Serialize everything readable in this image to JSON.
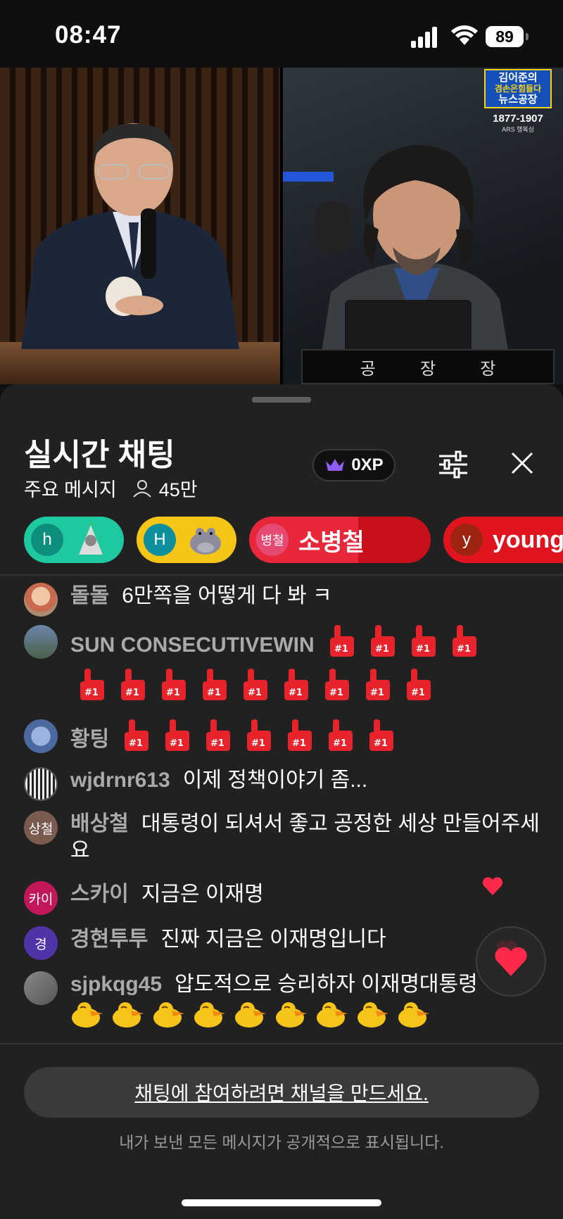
{
  "status_bar": {
    "time": "08:47",
    "battery": "89"
  },
  "video": {
    "nameplate": [
      "공",
      "장",
      "장"
    ],
    "logo": {
      "line1": "김어준의",
      "line2": "겸손은힘들다",
      "line3": "뉴스공장",
      "phone": "1877-1907",
      "ars": "ARS 행복심"
    }
  },
  "chat": {
    "title": "실시간 채팅",
    "mode_label": "주요 메시지",
    "viewer_count": "45만",
    "xp": "0XP"
  },
  "pinned": [
    {
      "initial": "h",
      "name": "",
      "color": "#1ec9a0"
    },
    {
      "initial": "H",
      "name": "",
      "color": "#f5c518"
    },
    {
      "initial": "병철",
      "name": "소병철",
      "color": "#e0141e"
    },
    {
      "initial": "y",
      "name": "young",
      "color": "#e0141e"
    }
  ],
  "messages": [
    {
      "author": "돌돌",
      "text": "6만쪽을 어떻게 다 봐 ㅋ",
      "avatar": ""
    },
    {
      "author": "SUN CONSECUTIVEWIN",
      "text": "",
      "avatar": ""
    },
    {
      "author": "황팅",
      "text": "",
      "avatar": ""
    },
    {
      "author": "wjdrnr613",
      "text": "이제 정책이야기 좀...",
      "avatar": ""
    },
    {
      "author": "배상철",
      "text": "대통령이 되셔서 좋고 공정한 세상 만들어주세요",
      "avatar": "상철"
    },
    {
      "author": "스카이",
      "text": "지금은 이재명",
      "avatar": "카이"
    },
    {
      "author": "경현투투",
      "text": "진짜 지금은 이재명입니다",
      "avatar": "경"
    },
    {
      "author": "sjpkqg45",
      "text": "압도적으로 승리하자 이재명대통령",
      "avatar": ""
    }
  ],
  "footer": {
    "join_text": "채팅에 참여하려면 채널을 만드세요.",
    "notice": "내가 보낸 모든 메시지가 공개적으로 표시됩니다."
  },
  "colors": {
    "sheet": "#212121",
    "author": "#aaaaaa",
    "accent_red": "#e0141e",
    "heart": "#ff2a4a"
  },
  "icons": [
    "crown-icon",
    "filter-icon",
    "close-icon",
    "person-icon",
    "number-one-finger-icon",
    "duck-emoji-icon",
    "heart-icon"
  ]
}
